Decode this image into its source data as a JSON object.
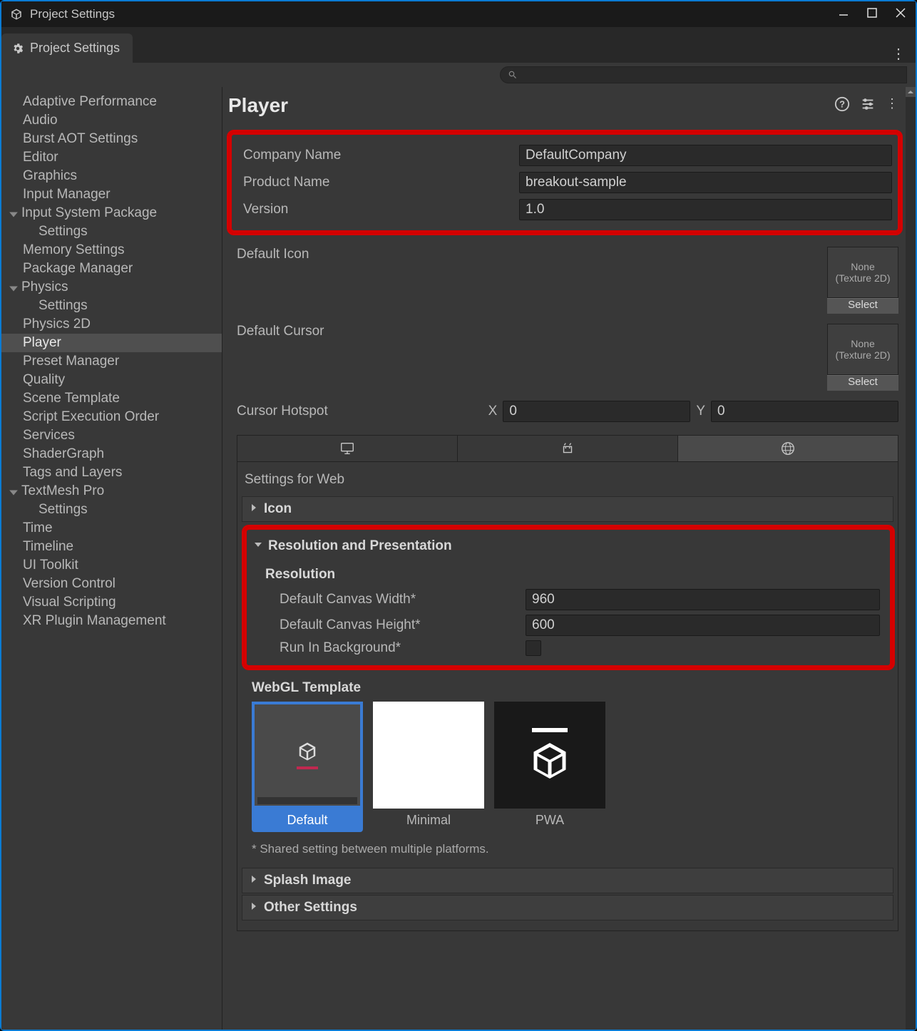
{
  "window_title": "Project Settings",
  "tab_title": "Project Settings",
  "sidebar_items": [
    {
      "label": "Adaptive Performance",
      "expandable": false
    },
    {
      "label": "Audio",
      "expandable": false
    },
    {
      "label": "Burst AOT Settings",
      "expandable": false
    },
    {
      "label": "Editor",
      "expandable": false
    },
    {
      "label": "Graphics",
      "expandable": false
    },
    {
      "label": "Input Manager",
      "expandable": false
    },
    {
      "label": "Input System Package",
      "expandable": true,
      "expanded": true,
      "children": [
        "Settings"
      ]
    },
    {
      "label": "Memory Settings",
      "expandable": false
    },
    {
      "label": "Package Manager",
      "expandable": false
    },
    {
      "label": "Physics",
      "expandable": true,
      "expanded": true,
      "children": [
        "Settings"
      ]
    },
    {
      "label": "Physics 2D",
      "expandable": false
    },
    {
      "label": "Player",
      "expandable": false,
      "selected": true
    },
    {
      "label": "Preset Manager",
      "expandable": false
    },
    {
      "label": "Quality",
      "expandable": false
    },
    {
      "label": "Scene Template",
      "expandable": false
    },
    {
      "label": "Script Execution Order",
      "expandable": false
    },
    {
      "label": "Services",
      "expandable": false
    },
    {
      "label": "ShaderGraph",
      "expandable": false
    },
    {
      "label": "Tags and Layers",
      "expandable": false
    },
    {
      "label": "TextMesh Pro",
      "expandable": true,
      "expanded": true,
      "children": [
        "Settings"
      ]
    },
    {
      "label": "Time",
      "expandable": false
    },
    {
      "label": "Timeline",
      "expandable": false
    },
    {
      "label": "UI Toolkit",
      "expandable": false
    },
    {
      "label": "Version Control",
      "expandable": false
    },
    {
      "label": "Visual Scripting",
      "expandable": false
    },
    {
      "label": "XR Plugin Management",
      "expandable": false
    }
  ],
  "content": {
    "title": "Player",
    "company_name_label": "Company Name",
    "company_name_value": "DefaultCompany",
    "product_name_label": "Product Name",
    "product_name_value": "breakout-sample",
    "version_label": "Version",
    "version_value": "1.0",
    "default_icon_label": "Default Icon",
    "default_cursor_label": "Default Cursor",
    "texture_none": "None\n(Texture 2D)",
    "select_label": "Select",
    "cursor_hotspot_label": "Cursor Hotspot",
    "cursor_x_label": "X",
    "cursor_x_value": "0",
    "cursor_y_label": "Y",
    "cursor_y_value": "0",
    "settings_for_label": "Settings for Web",
    "icon_fold_label": "Icon",
    "res_pres_label": "Resolution and Presentation",
    "resolution_heading": "Resolution",
    "canvas_width_label": "Default Canvas Width*",
    "canvas_width_value": "960",
    "canvas_height_label": "Default Canvas Height*",
    "canvas_height_value": "600",
    "run_bg_label": "Run In Background*",
    "webgl_template_heading": "WebGL Template",
    "templates": [
      {
        "label": "Default",
        "selected": true
      },
      {
        "label": "Minimal",
        "selected": false
      },
      {
        "label": "PWA",
        "selected": false
      }
    ],
    "footnote": "* Shared setting between multiple platforms.",
    "splash_fold_label": "Splash Image",
    "other_fold_label": "Other Settings"
  }
}
